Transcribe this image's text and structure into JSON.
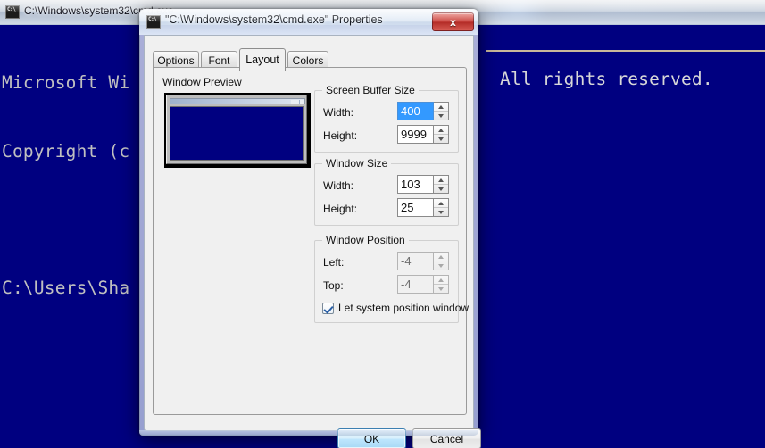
{
  "console": {
    "title": "C:\\Windows\\system32\\cmd.exe",
    "icon": "cmd-icon",
    "lines": [
      "Microsoft Wi",
      "Copyright (c",
      "",
      "C:\\Users\\Sha"
    ],
    "right_text": "All rights reserved.",
    "background_color": "#000080",
    "text_color": "#c0c0c0"
  },
  "dialog": {
    "title": "\"C:\\Windows\\system32\\cmd.exe\" Properties",
    "icon": "cmd-icon",
    "close_label": "x",
    "close_icon": "close-icon",
    "tabs": [
      {
        "label": "Options",
        "active": false
      },
      {
        "label": "Font",
        "active": false
      },
      {
        "label": "Layout",
        "active": true
      },
      {
        "label": "Colors",
        "active": false
      }
    ],
    "preview": {
      "label": "Window Preview",
      "screen_color": "#000080"
    },
    "groups": [
      {
        "title": "Screen Buffer Size",
        "fields": [
          {
            "label": "Width:",
            "value": "400",
            "state": "selected"
          },
          {
            "label": "Height:",
            "value": "9999",
            "state": "normal"
          }
        ]
      },
      {
        "title": "Window Size",
        "fields": [
          {
            "label": "Width:",
            "value": "103",
            "state": "normal"
          },
          {
            "label": "Height:",
            "value": "25",
            "state": "normal"
          }
        ]
      },
      {
        "title": "Window Position",
        "fields": [
          {
            "label": "Left:",
            "value": "-4",
            "state": "disabled"
          },
          {
            "label": "Top:",
            "value": "-4",
            "state": "disabled"
          }
        ],
        "checkbox": {
          "label": "Let system position window",
          "checked": true
        }
      }
    ],
    "buttons": {
      "ok": "OK",
      "cancel": "Cancel"
    }
  },
  "colors": {
    "console_blue": "#000080",
    "selection_blue": "#3399ff",
    "ok_accent": "#3c7fb1",
    "close_red": "#c9423c"
  }
}
